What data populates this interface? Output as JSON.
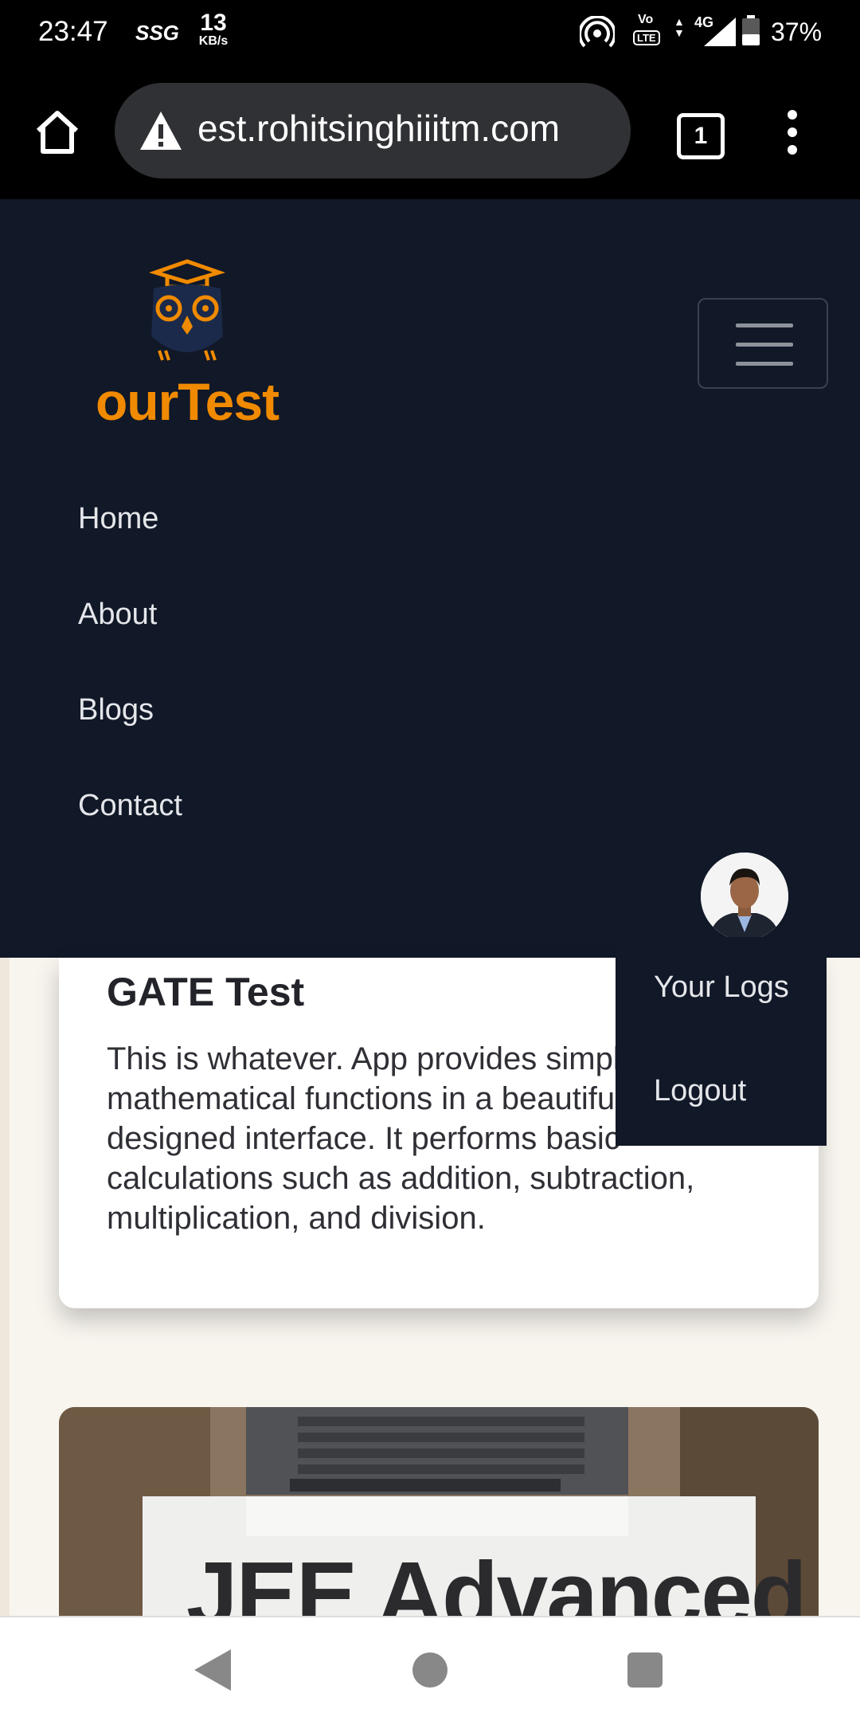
{
  "status_bar": {
    "time": "23:47",
    "carrier_badge": "SSG",
    "net_speed_value": "13",
    "net_speed_unit": "KB/s",
    "volte_top": "Vo",
    "volte_bottom": "LTE",
    "network_type": "4G",
    "battery_percent": "37%",
    "icons": [
      "hotspot-icon",
      "volte-icon",
      "data-arrows-icon",
      "signal-icon",
      "battery-icon"
    ]
  },
  "browser": {
    "url_display": "est.rohitsinghiiitm.com",
    "tab_count": "1",
    "icons": [
      "home-icon",
      "not-secure-warning-icon",
      "tabs-icon",
      "overflow-menu-icon"
    ]
  },
  "site_nav": {
    "brand": "ourTest",
    "menu_items": [
      "Home",
      "About",
      "Blogs",
      "Contact"
    ]
  },
  "dropdown": {
    "items": [
      "Your Logs",
      "Logout"
    ]
  },
  "cards": [
    {
      "title": "GATE Test",
      "description": "This is whatever. App provides simple mathematical functions in a beautifully designed interface. It performs basic calculations such as addition, subtraction, multiplication, and division."
    },
    {
      "image_title": "JEE Advanced"
    }
  ],
  "colors": {
    "nav_background": "#111827",
    "brand_orange": "#f08a00",
    "page_background": "#f8f5ef"
  }
}
